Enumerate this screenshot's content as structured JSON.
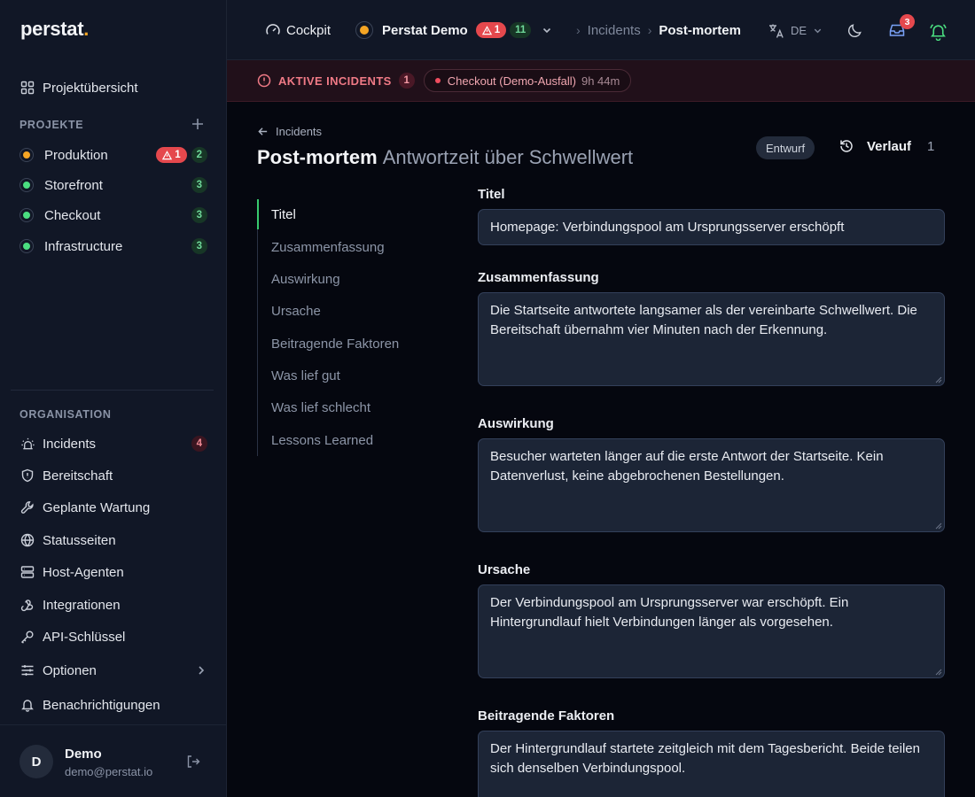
{
  "brand": {
    "name": "perstat",
    "dot": "."
  },
  "sidebar": {
    "overview": "Projektübersicht",
    "projects_title": "PROJEKTE",
    "projects": [
      {
        "name": "Produktion",
        "color": "#f5a524",
        "alert": "1",
        "count": "2"
      },
      {
        "name": "Storefront",
        "color": "#4ade80",
        "count": "3"
      },
      {
        "name": "Checkout",
        "color": "#4ade80",
        "count": "3"
      },
      {
        "name": "Infrastructure",
        "color": "#4ade80",
        "count": "3"
      }
    ],
    "org_title": "ORGANISATION",
    "org_items": [
      {
        "label": "Incidents",
        "icon": "siren-icon",
        "count": "4"
      },
      {
        "label": "Bereitschaft",
        "icon": "shield-icon"
      },
      {
        "label": "Geplante Wartung",
        "icon": "wrench-icon"
      },
      {
        "label": "Statusseiten",
        "icon": "globe-icon"
      },
      {
        "label": "Host-Agenten",
        "icon": "server-icon"
      },
      {
        "label": "Integrationen",
        "icon": "webhook-icon"
      },
      {
        "label": "API-Schlüssel",
        "icon": "key-icon"
      },
      {
        "label": "Optionen",
        "icon": "sliders-icon"
      },
      {
        "label": "Benachrichtigungen",
        "icon": "bell-icon"
      }
    ],
    "user": {
      "initial": "D",
      "name": "Demo",
      "email": "demo@perstat.io"
    }
  },
  "topbar": {
    "cockpit": "Cockpit",
    "project": "Perstat Demo",
    "project_alert": "1",
    "project_count": "11",
    "breadcrumb": [
      "Incidents",
      "Post-mortem"
    ],
    "language": "DE",
    "notification_count": "3"
  },
  "alertbar": {
    "title": "AKTIVE INCIDENTS",
    "count": "1",
    "incident_name": "Checkout (Demo-Ausfall)",
    "incident_duration": "9h 44m"
  },
  "main": {
    "back_label": "Incidents",
    "title": "Post-mortem",
    "subtitle": "Antwortzeit über Schwellwert",
    "status": "Entwurf",
    "history_label": "Verlauf",
    "history_count": "1",
    "toc": [
      "Titel",
      "Zusammenfassung",
      "Auswirkung",
      "Ursache",
      "Beitragende Faktoren",
      "Was lief gut",
      "Was lief schlecht",
      "Lessons Learned"
    ],
    "fields": {
      "title_label": "Titel",
      "title_value": "Homepage: Verbindungspool am Ursprungsserver erschöpft",
      "summary_label": "Zusammenfassung",
      "summary_value": "Die Startseite antwortete langsamer als der vereinbarte Schwellwert. Die Bereitschaft übernahm vier Minuten nach der Erkennung.",
      "impact_label": "Auswirkung",
      "impact_value": "Besucher warteten länger auf die erste Antwort der Startseite. Kein Datenverlust, keine abgebrochenen Bestellungen.",
      "cause_label": "Ursache",
      "cause_value": "Der Verbindungspool am Ursprungsserver war erschöpft. Ein Hintergrundlauf hielt Verbindungen länger als vorgesehen.",
      "factors_label": "Beitragende Faktoren",
      "factors_value": "Der Hintergrundlauf startete zeitgleich mit dem Tagesbericht. Beide teilen sich denselben Verbindungspool."
    }
  }
}
